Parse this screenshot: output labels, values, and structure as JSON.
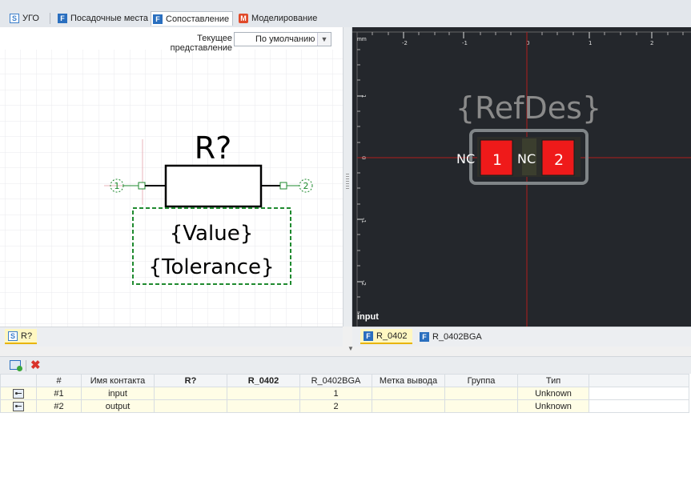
{
  "tabs": [
    {
      "icon": "S",
      "label": "УГО"
    },
    {
      "icon": "F",
      "label": "Посадочные места"
    },
    {
      "icon": "F",
      "label": "Сопоставление"
    },
    {
      "icon": "M",
      "label": "Моделирование"
    }
  ],
  "view": {
    "label": "Текущее представление",
    "value": "По умолчанию"
  },
  "symbol": {
    "refdes": "R?",
    "value": "{Value}",
    "tolerance": "{Tolerance}",
    "pin1": "1",
    "pin2": "2"
  },
  "footprint": {
    "unit": "mm",
    "x_ticks": [
      "-2",
      "-1",
      "0",
      "1",
      "2"
    ],
    "y_ticks": [
      "1",
      "0",
      "-1",
      "-2"
    ],
    "refdes": "{RefDes}",
    "pad1": "1",
    "pad2": "2",
    "nc_left": "NC",
    "nc_mid": "NC",
    "hover_pin": "input"
  },
  "left_bottom_tabs": [
    {
      "icon": "S",
      "label": "R?"
    }
  ],
  "right_bottom_tabs": [
    {
      "icon": "F",
      "label": "R_0402"
    },
    {
      "icon": "F",
      "label": "R_0402BGA"
    }
  ],
  "table": {
    "headers": [
      "",
      "#",
      "Имя контакта",
      "R?",
      "R_0402",
      "R_0402BGA",
      "Метка вывода",
      "Группа",
      "Тип"
    ],
    "rows": [
      {
        "num": "#1",
        "name": "input",
        "sym": "",
        "fp1": "",
        "fp2": "1",
        "mark": "",
        "group": "",
        "type": "Unknown"
      },
      {
        "num": "#2",
        "name": "output",
        "sym": "",
        "fp1": "",
        "fp2": "2",
        "mark": "",
        "group": "",
        "type": "Unknown"
      }
    ]
  },
  "colors": {
    "pad": "#ef1a1a",
    "pin_green": "#1f8a2f",
    "accent": "#2a6fbf",
    "canvas": "#24272c"
  }
}
